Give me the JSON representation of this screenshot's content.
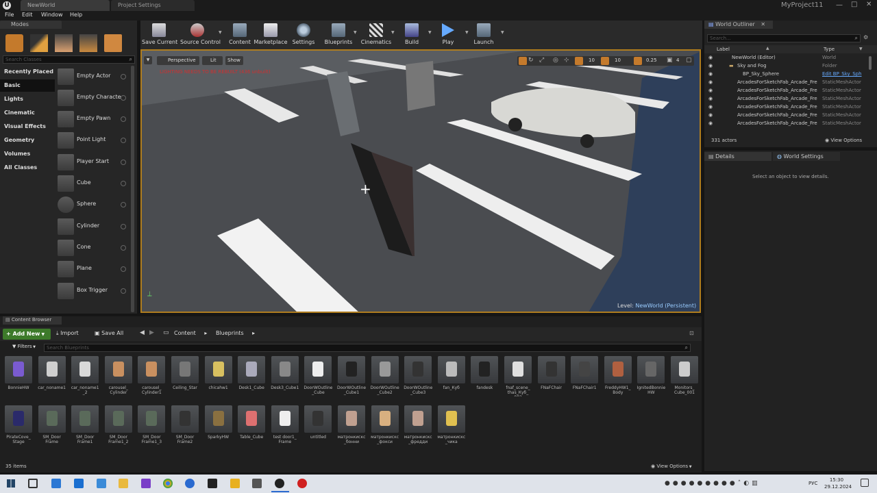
{
  "titlebar": {
    "tabs": [
      "NewWorld",
      "Project Settings"
    ],
    "project_name": "MyProject11"
  },
  "menu": [
    "File",
    "Edit",
    "Window",
    "Help"
  ],
  "modes": {
    "title": "Modes",
    "search_placeholder": "Search Classes",
    "categories": [
      "Recently Placed",
      "Basic",
      "Lights",
      "Cinematic",
      "Visual Effects",
      "Geometry",
      "Volumes",
      "All Classes"
    ],
    "placeables": [
      "Empty Actor",
      "Empty Characte",
      "Empty Pawn",
      "Point Light",
      "Player Start",
      "Cube",
      "Sphere",
      "Cylinder",
      "Cone",
      "Plane",
      "Box Trigger"
    ]
  },
  "toolbar": {
    "buttons": [
      "Save Current",
      "Source Control",
      "Content",
      "Marketplace",
      "Settings",
      "Blueprints",
      "Cinematics",
      "Build",
      "Play",
      "Launch"
    ]
  },
  "viewport": {
    "perspective": "Perspective",
    "lit": "Lit",
    "show": "Show",
    "warning": "LIGHTING NEEDS TO BE REBUILT (436 unbuilt)",
    "snap_values": [
      "10",
      "10",
      "0.25",
      "4"
    ],
    "level_label": "Level:",
    "level_name": "NewWorld (Persistent)"
  },
  "outliner": {
    "title": "World Outliner",
    "search_placeholder": "Search...",
    "col_label": "Label",
    "col_type": "Type",
    "rows": [
      {
        "label": "NewWorld (Editor)",
        "type": "World"
      },
      {
        "label": "Sky and Fog",
        "type": "Folder"
      },
      {
        "label": "BP_Sky_Sphere",
        "type": "Edit BP_Sky_Sph"
      },
      {
        "label": "ArcadesForSketchFab_Arcade_Fre",
        "type": "StaticMeshActor"
      },
      {
        "label": "ArcadesForSketchFab_Arcade_Fre",
        "type": "StaticMeshActor"
      },
      {
        "label": "ArcadesForSketchFab_Arcade_Fre",
        "type": "StaticMeshActor"
      },
      {
        "label": "ArcadesForSketchFab_Arcade_Fre",
        "type": "StaticMeshActor"
      },
      {
        "label": "ArcadesForSketchFab_Arcade_Fre",
        "type": "StaticMeshActor"
      },
      {
        "label": "ArcadesForSketchFab_Arcade_Fre",
        "type": "StaticMeshActor"
      }
    ],
    "count": "331 actors",
    "view_options": "View Options"
  },
  "details": {
    "tab_details": "Details",
    "tab_world": "World Settings",
    "empty": "Select an object to view details."
  },
  "content_browser": {
    "title": "Content Browser",
    "add_new": "Add New",
    "import": "Import",
    "save_all": "Save All",
    "path": [
      "Content",
      "Blueprints"
    ],
    "filters": "Filters",
    "search_placeholder": "Search Blueprints",
    "assets": [
      "BonnieHW",
      "car_noname1",
      "car_noname1\n_2",
      "carousel_\nCylinder",
      "carousel_\nCylinder1",
      "Ceiling_Star",
      "chicahw1",
      "Desk1_Cube",
      "Desk3_Cube1",
      "DoorWOutline\n_Cube",
      "DoorWOutline\n_Cube1",
      "DoorWOutline\n_Cube2",
      "DoorWOutline\n_Cube3",
      "fan_Куб",
      "fandesk",
      "fnaf_scene_\nthas_Куб_\n002",
      "FNaFChair",
      "FNaFChair1",
      "FreddyHW1_\nBody",
      "IgnitedBonnie\nHW",
      "Monitors_\nCube_001",
      "PirateCove_\nStage",
      "SM_Door\nFrame",
      "SM_Door\nFrame1",
      "SM_Door\nFrame1_2",
      "SM_Door\nFrame1_3",
      "SM_Door\nFrame2",
      "SparkyHW",
      "Table_Cube",
      "test door1_\nFrame",
      "untitled",
      "матронкискс\n_бонни",
      "матронкискс\n_фокси",
      "матронкискс\n_фредди",
      "матронкискс\n_чика"
    ],
    "item_count": "35 items",
    "view_options": "View Options"
  },
  "taskbar": {
    "lang": "РУС",
    "time": "15:30",
    "date": "29.12.2024"
  }
}
